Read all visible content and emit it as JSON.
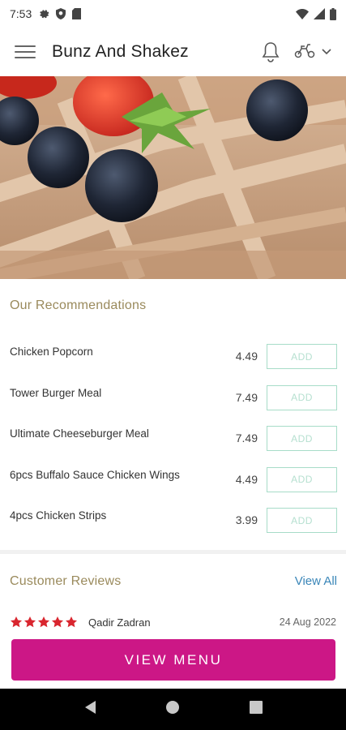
{
  "status_bar": {
    "time": "7:53"
  },
  "app_bar": {
    "title": "Bunz And Shakez"
  },
  "recommendations": {
    "title": "Our Recommendations",
    "items": [
      {
        "name": "Chicken Popcorn",
        "price": "4.49",
        "action": "ADD"
      },
      {
        "name": "Tower Burger Meal",
        "price": "7.49",
        "action": "ADD"
      },
      {
        "name": "Ultimate Cheeseburger Meal",
        "price": "7.49",
        "action": "ADD"
      },
      {
        "name": "6pcs Buffalo Sauce Chicken Wings",
        "price": "4.49",
        "action": "ADD"
      },
      {
        "name": "4pcs Chicken Strips",
        "price": "3.99",
        "action": "ADD"
      }
    ]
  },
  "reviews": {
    "title": "Customer Reviews",
    "view_all": "View All",
    "items": [
      {
        "reviewer": "Qadir Zadran",
        "rating": 5,
        "date": "24 Aug 2022"
      }
    ]
  },
  "cta": {
    "label": "VIEW MENU"
  },
  "colors": {
    "accent": "#cc1786",
    "section_title": "#9a8a5c",
    "link": "#3a86b8",
    "add_border": "#a7dcc8",
    "star": "#d9262f"
  }
}
